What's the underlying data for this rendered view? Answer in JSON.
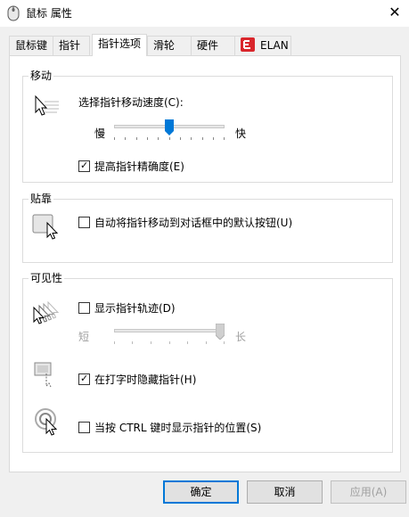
{
  "window": {
    "title": "鼠标 属性",
    "close_glyph": "✕"
  },
  "tabs": [
    {
      "label": "鼠标键",
      "active": false
    },
    {
      "label": "指针",
      "active": false
    },
    {
      "label": "指针选项",
      "active": true
    },
    {
      "label": "滑轮",
      "active": false
    },
    {
      "label": "硬件",
      "active": false
    },
    {
      "label": "ELAN",
      "active": false,
      "icon": "elan-icon"
    }
  ],
  "motion": {
    "title": "移动",
    "speed_label": "选择指针移动速度(C):",
    "slow_label": "慢",
    "fast_label": "快",
    "speed_fraction": 0.5,
    "precision_label": "提高指针精确度(E)",
    "precision_checked": true
  },
  "snap": {
    "title": "贴靠",
    "snap_label": "自动将指针移动到对话框中的默认按钮(U)",
    "snap_checked": false
  },
  "visibility": {
    "title": "可见性",
    "trails_label": "显示指针轨迹(D)",
    "trails_checked": false,
    "short_label": "短",
    "long_label": "长",
    "trails_fraction": 1.0,
    "hide_label": "在打字时隐藏指针(H)",
    "hide_checked": true,
    "ctrl_label": "当按 CTRL 键时显示指针的位置(S)",
    "ctrl_checked": false
  },
  "buttons": {
    "ok": "确定",
    "cancel": "取消",
    "apply": "应用(A)"
  },
  "colors": {
    "accent": "#0078d7",
    "slider_thumb": "#0078d7",
    "disabled_text": "#a0a0a0"
  }
}
